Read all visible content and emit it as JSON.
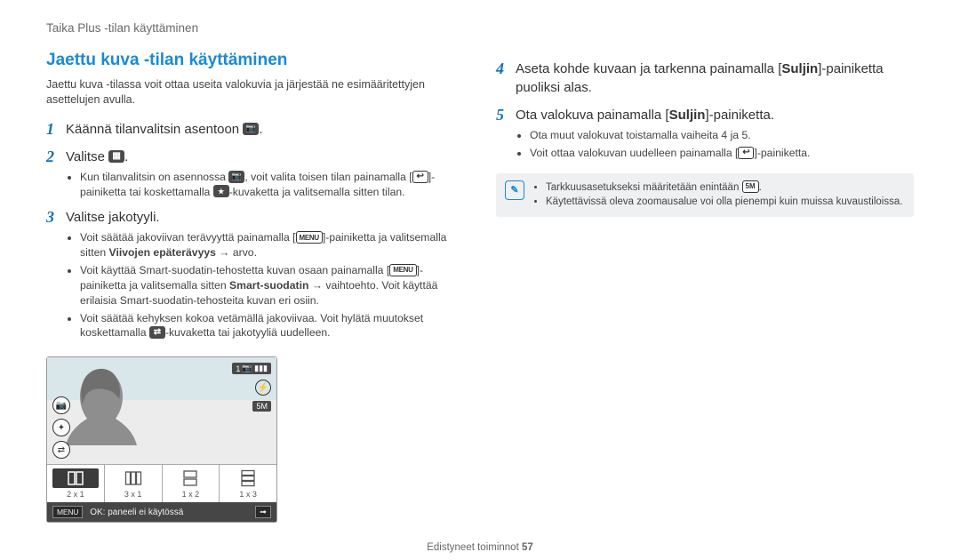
{
  "header": {
    "breadcrumb": "Taika Plus -tilan käyttäminen"
  },
  "left": {
    "title": "Jaettu kuva -tilan käyttäminen",
    "intro": "Jaettu kuva -tilassa voit ottaa useita valokuvia ja järjestää ne esimääritettyjen asettelujen avulla.",
    "step1": {
      "num": "1",
      "text_a": "Käännä tilanvalitsin asentoon ",
      "text_b": "."
    },
    "step2": {
      "num": "2",
      "text_a": "Valitse ",
      "text_b": "."
    },
    "step2_bul": {
      "a": "Kun tilanvalitsin on asennossa ",
      "b": ", voit valita toisen tilan painamalla [",
      "c": "]-painiketta tai koskettamalla ",
      "d": "-kuvaketta ja valitsemalla sitten tilan."
    },
    "step3": {
      "num": "3",
      "text": "Valitse jakotyyli."
    },
    "step3_b1a": "Voit säätää jakoviivan terävyyttä painamalla [",
    "step3_b1b": "]-painiketta ja valitsemalla sitten ",
    "step3_b1c": "Viivojen epäterävyys",
    "step3_b1d": " → arvo.",
    "step3_b2a": "Voit käyttää Smart-suodatin-tehostetta kuvan osaan painamalla [",
    "step3_b2b": "]-painiketta ja valitsemalla sitten ",
    "step3_b2c": "Smart-suodatin",
    "step3_b2d": " → vaihtoehto. Voit käyttää erilaisia Smart-suodatin-tehosteita kuvan eri osiin.",
    "step3_b3a": "Voit säätää kehyksen kokoa vetämällä jakoviivaa. Voit hylätä muutokset koskettamalla ",
    "step3_b3b": "-kuvaketta tai jakotyyliä uudelleen.",
    "shot": {
      "layouts": [
        "2 x 1",
        "3 x 1",
        "1 x 2",
        "1 x 3"
      ],
      "menu": "MENU",
      "ok": "OK: paneeli ei käytössä",
      "count": "1",
      "five": "5M"
    }
  },
  "right": {
    "step4": {
      "num": "4",
      "a": "Aseta kohde kuvaan ja tarkenna painamalla [",
      "b": "Suljin",
      "c": "]-painiketta puoliksi alas."
    },
    "step5": {
      "num": "5",
      "a": "Ota valokuva painamalla [",
      "b": "Suljin",
      "c": "]-painiketta."
    },
    "step5_b1": "Ota muut valokuvat toistamalla vaiheita 4 ja 5.",
    "step5_b2a": "Voit ottaa valokuvan uudelleen painamalla [",
    "step5_b2b": "]-painiketta.",
    "note_b1a": "Tarkkuusasetukseksi määritetään enintään ",
    "note_b1b": ".",
    "note_b2": "Käytettävissä oleva zoomausalue voi olla pienempi kuin muissa kuvaustiloissa."
  },
  "footer": {
    "a": "Edistyneet toiminnot  ",
    "b": "57"
  },
  "menu_label": "MENU"
}
